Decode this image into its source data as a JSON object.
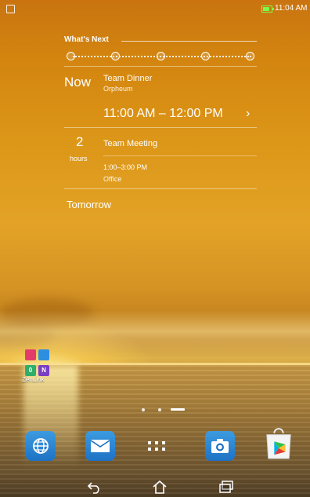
{
  "status_bar": {
    "time": "11:04 AM",
    "battery_level": 0.75,
    "battery_color": "#7CFC4A",
    "left_icon": "notification-icon"
  },
  "widget": {
    "title": "What's Next",
    "event1": {
      "label": "Now",
      "title": "Team Dinner",
      "location": "Orpheum",
      "time_range": "11:00 AM – 12:00 PM"
    },
    "event2": {
      "hours_value": "2",
      "hours_unit": "hours",
      "title": "Team Meeting",
      "time_range": "1:00–3:00 PM",
      "location": "Office"
    },
    "tomorrow_label": "Tomorrow"
  },
  "folder": {
    "label": "ZenLink",
    "icons": [
      {
        "name": "share-link-icon",
        "color": "#e23d6a",
        "glyph": ""
      },
      {
        "name": "party-link-icon",
        "color": "#2d8fe0",
        "glyph": ""
      },
      {
        "name": "pc-link-icon",
        "color": "#2fae6a",
        "glyph": "0"
      },
      {
        "name": "remote-link-icon",
        "color": "#7a3fc2",
        "glyph": "N"
      }
    ]
  },
  "pager": {
    "pages": 3,
    "current": 3
  },
  "dock": [
    "browser-icon",
    "email-icon",
    "all-apps-icon",
    "camera-icon",
    "play-store-icon"
  ],
  "nav": [
    "back-icon",
    "home-icon",
    "recent-apps-icon"
  ]
}
